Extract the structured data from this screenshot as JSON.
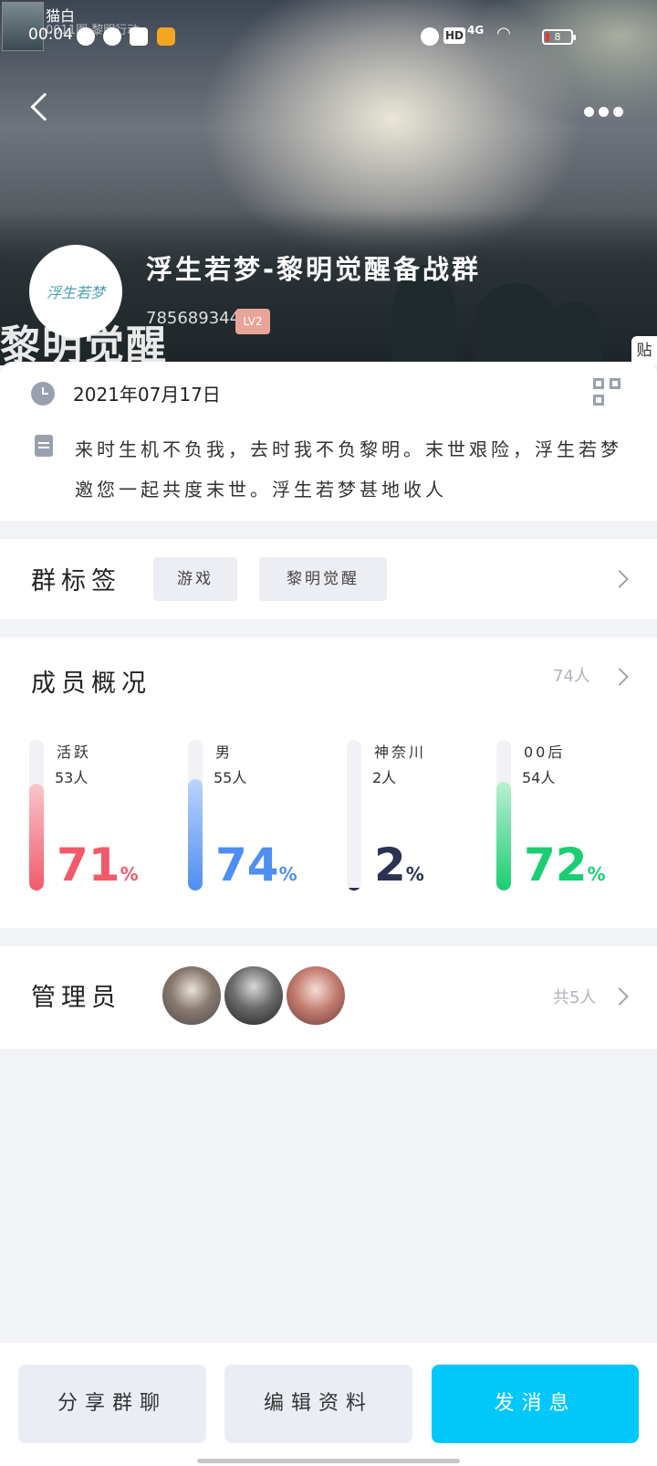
{
  "status_bar": {
    "notif_name": "猫白",
    "notif_sub": "0011图 黎明行动",
    "time": "00:04",
    "network": "4G",
    "hd": "HD",
    "battery": "8"
  },
  "header": {
    "group_name": "浮生若梦-黎明觉醒备战群",
    "group_id": "785689344",
    "level": "LV2",
    "watermark": "黎明觉醒",
    "avatar_text": "浮生若梦",
    "tie_label": "贴"
  },
  "info": {
    "created_date": "2021年07月17日",
    "description": "来时生机不负我，去时我不负黎明。末世艰险，浮生若梦邀您一起共度末世。浮生若梦甚地收人"
  },
  "tags": {
    "title": "群标签",
    "items": [
      "游戏",
      "黎明觉醒"
    ]
  },
  "members": {
    "title": "成员概况",
    "total": "74人",
    "stats": [
      {
        "label": "活跃",
        "count": "53人",
        "percent": 71,
        "color": "#f25a6b",
        "fill_from": "#f8c6cc"
      },
      {
        "label": "男",
        "count": "55人",
        "percent": 74,
        "color": "#4f8ef2",
        "fill_from": "#bcd3fb"
      },
      {
        "label": "神奈川",
        "count": "2人",
        "percent": 2,
        "color": "#2b3352",
        "fill_from": "#2b3352"
      },
      {
        "label": "00后",
        "count": "54人",
        "percent": 72,
        "color": "#1ccd72",
        "fill_from": "#b8f0d2"
      }
    ]
  },
  "admins": {
    "title": "管理员",
    "total": "共5人"
  },
  "actions": {
    "share": "分享群聊",
    "edit": "编辑资料",
    "send": "发消息"
  }
}
